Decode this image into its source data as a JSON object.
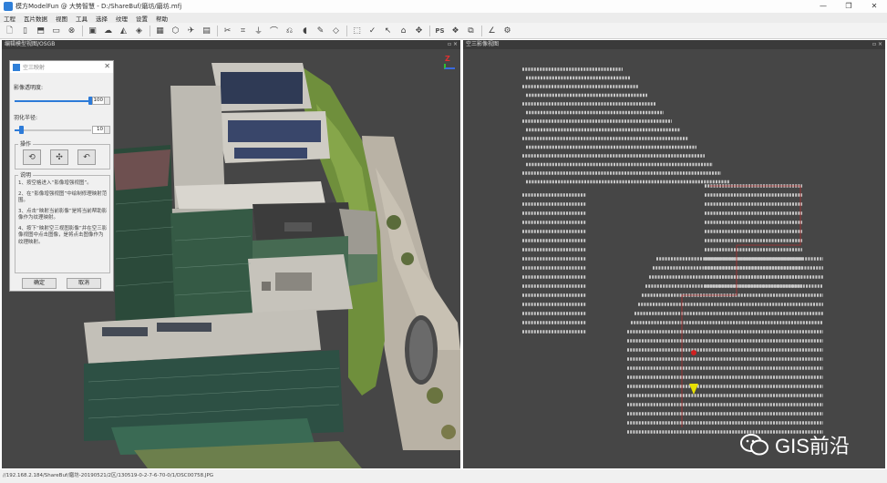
{
  "window": {
    "title": "模方ModelFun @ 大势智慧 - D:/ShareBuf/磨坊/磨坊.mfj",
    "minimize": "—",
    "maximize": "❐",
    "close": "✕"
  },
  "menu": [
    "工程",
    "瓦片数据",
    "视图",
    "工具",
    "选择",
    "纹理",
    "设置",
    "帮助"
  ],
  "toolbar": {
    "ps_label": "PS"
  },
  "left_panel": {
    "title": "编辑模型视图/OSGB",
    "controls": "▫ ×",
    "axis_label": "Z"
  },
  "right_panel": {
    "title": "空三影像视图",
    "controls": "▫ ×"
  },
  "dialog": {
    "title": "空三映射",
    "close": "✕",
    "opacity_label": "影像透明度:",
    "opacity_value": "100",
    "opacity_fraction": 1.0,
    "radius_label": "羽化半径:",
    "radius_value": "10",
    "radius_fraction": 0.1,
    "ops_legend": "操作",
    "notes_legend": "说明",
    "notes": [
      "1、按空格进入“影像增强视图”。",
      "2、在“影像增强视图”中绘制修理映射范围。",
      "3、点击“映射当前影像”是将当前帮助影像作为纹理映射。",
      "4、按下“映射空三视图影像”并在空三影像视图中点击图像，是将点击图像作为纹理映射。"
    ],
    "ok": "确定",
    "cancel": "取消"
  },
  "status": {
    "path": "//192.168.2.184/ShareBuf/磨坊-20190521/2区/130519-0-2-7-6-70-0/1/DSC00758.JPG"
  },
  "watermark": {
    "text": "GIS前沿"
  }
}
